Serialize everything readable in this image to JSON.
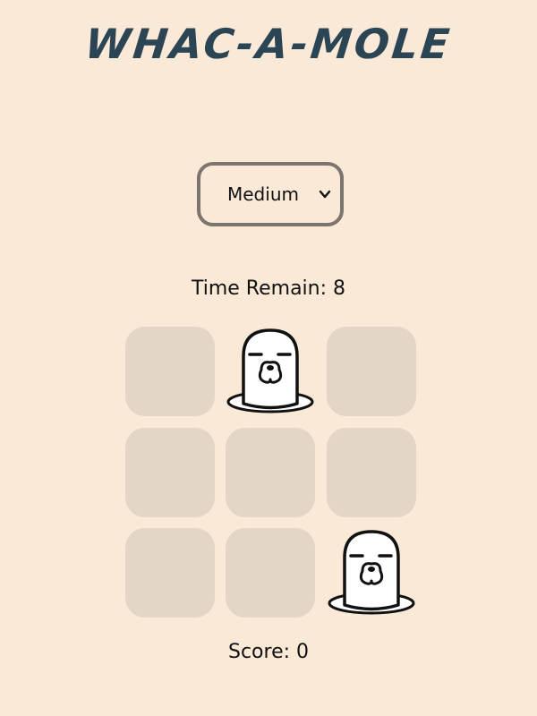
{
  "game": {
    "title": "Whac-a-mole",
    "difficulty": {
      "selected": "Medium"
    },
    "timer": {
      "label": "Time Remain:",
      "value": "8"
    },
    "score": {
      "label": "Score:",
      "value": "0"
    },
    "board": {
      "rows": 3,
      "cols": 3,
      "active_holes": [
        1,
        8
      ]
    }
  },
  "colors": {
    "background": "#f9e9d6",
    "title": "#2c4555",
    "hole": "#e3d6c7",
    "select_border": "#7d746f"
  },
  "icons": {
    "mole": "mole-icon",
    "dropdown": "chevron-down-icon"
  }
}
